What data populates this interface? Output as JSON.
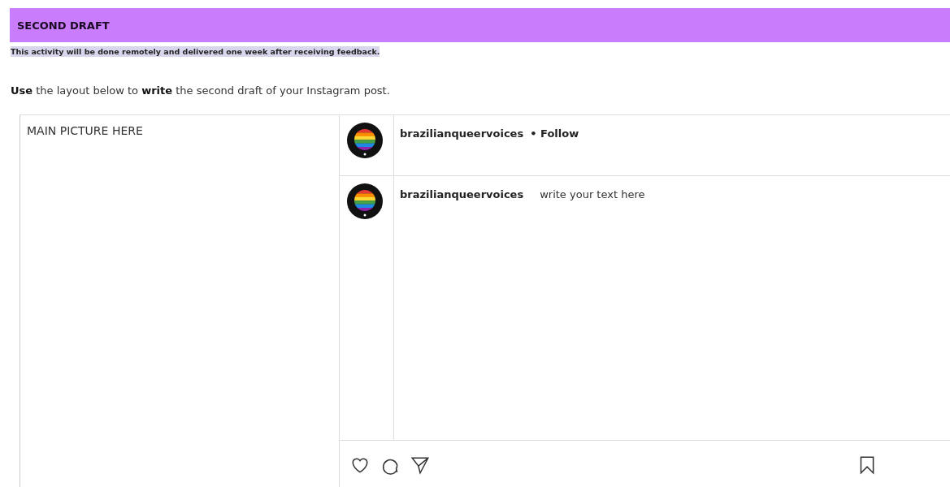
{
  "header": {
    "title": "SECOND DRAFT"
  },
  "note": "This activity will be done remotely and delivered one week after receiving feedback.",
  "instruction": "**Use** the layout below to **write** the second draft of your Instagram post.",
  "post": {
    "picture_label": "MAIN PICTURE HERE",
    "header_row": {
      "username": "brazilianqueervoices",
      "follow": "• Follow"
    },
    "caption_row": {
      "username": "brazilianqueervoices",
      "text": "write your text here"
    }
  }
}
